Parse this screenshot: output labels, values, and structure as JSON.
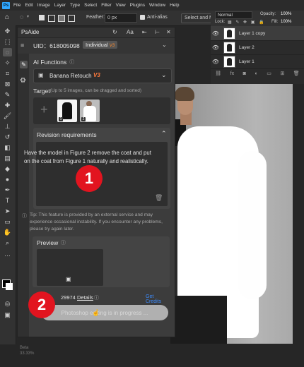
{
  "menubar": {
    "logo": "Ps",
    "items": [
      "File",
      "Edit",
      "Image",
      "Layer",
      "Type",
      "Select",
      "Filter",
      "View",
      "Plugins",
      "Window",
      "Help"
    ]
  },
  "options": {
    "feather_label": "Feather:",
    "feather_value": "0 px",
    "anti_alias_label": "Anti-alias",
    "select_mask_label": "Select and Mask..."
  },
  "layers": {
    "blend_mode": "Normal",
    "opacity_label": "Opacity:",
    "opacity_value": "100%",
    "lock_label": "Lock:",
    "fill_label": "Fill:",
    "fill_value": "100%",
    "items": [
      {
        "name": "Layer 1 copy"
      },
      {
        "name": "Layer 2"
      },
      {
        "name": "Layer 1"
      }
    ]
  },
  "plugin": {
    "title": "PsAide",
    "uid_label": "UID：618005098",
    "account_badge": "Individual",
    "vip_tag": "V3",
    "ai_functions_label": "AI Functions",
    "selected_function": "Banana Retouch",
    "function_version": "V3",
    "target_label": "Target",
    "target_hint": "(Up to 5 images, can be dragged and sorted)",
    "thumb_badges": [
      "1",
      "2"
    ],
    "revision_label": "Revision requirements",
    "revision_text": "Have the model in Figure 2 remove the coat and put on the coat from Figure 1 naturally and realistically.",
    "tip_text": "Tip: This feature is provided by an external service and may experience occasional instability. If you encounter any problems, please try again later.",
    "preview_label": "Preview",
    "points_value": "29974",
    "details_link": "Details",
    "get_credits_link": "Get Credits",
    "progress_text": "Photoshop editing is in progress ..."
  },
  "annotations": {
    "marker_1": "1",
    "marker_2": "2"
  },
  "status": {
    "beta_label": "Beta",
    "zoom": "33.33%"
  }
}
